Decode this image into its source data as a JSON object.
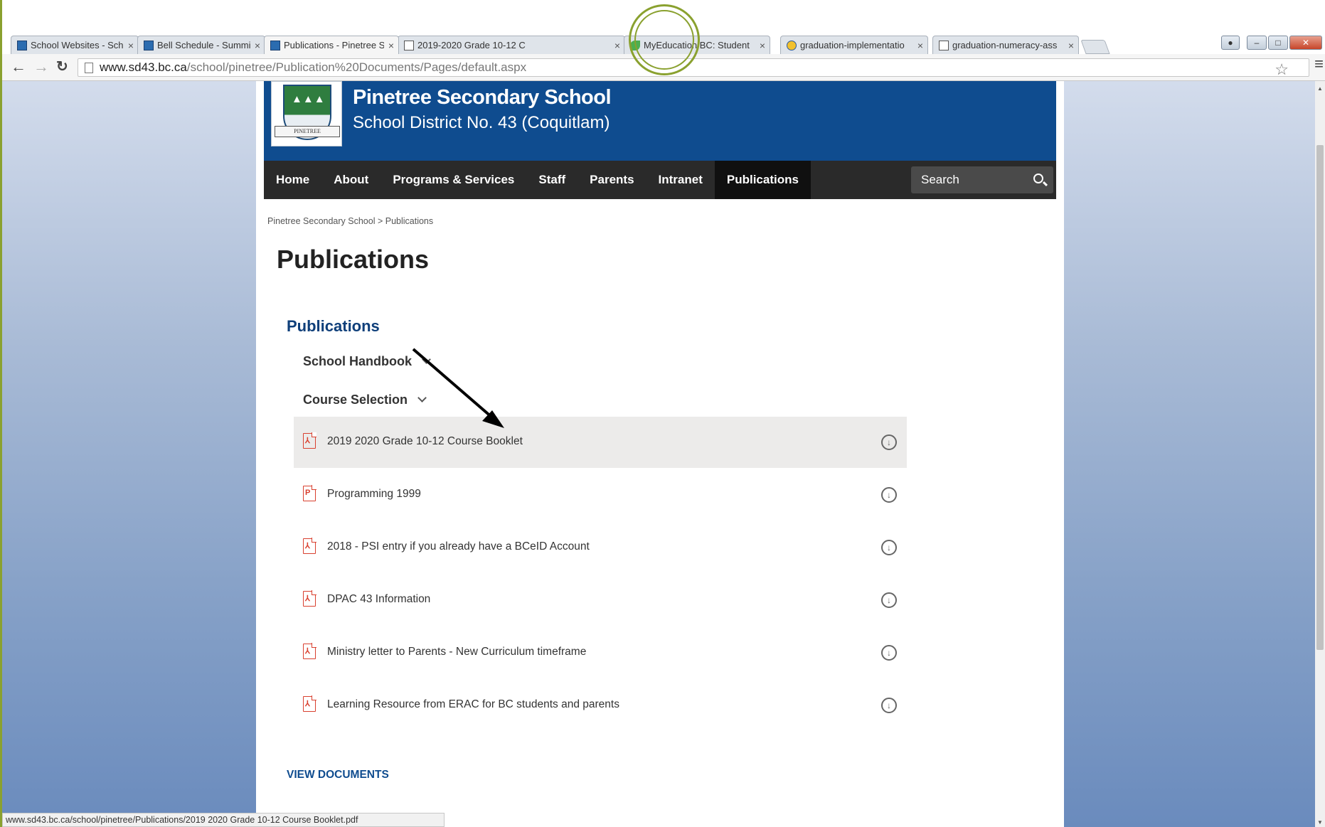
{
  "browser": {
    "tabs": [
      {
        "title": "School Websites - School",
        "icon": "sd43-icon",
        "active": false
      },
      {
        "title": "Bell Schedule - Summit M",
        "icon": "sd43-icon",
        "active": false
      },
      {
        "title": "Publications - Pinetree Se",
        "icon": "sd43-icon",
        "active": true
      },
      {
        "title": "2019-2020 Grade 10-12 C",
        "icon": "document-icon",
        "active": false
      },
      {
        "title": "MyEducation BC: Student",
        "icon": "leaf-icon",
        "active": false
      },
      {
        "title": "graduation-implementatio",
        "icon": "bc-gov-icon",
        "active": false
      },
      {
        "title": "graduation-numeracy-ass",
        "icon": "document-icon",
        "active": false
      }
    ],
    "tab_close_glyph": "×",
    "url_domain": "www.sd43.bc.ca",
    "url_path": "/school/pinetree/Publication%20Documents/Pages/default.aspx",
    "status_url": "www.sd43.bc.ca/school/pinetree/Publications/2019 2020 Grade 10-12 Course Booklet.pdf"
  },
  "site": {
    "school_name": "Pinetree Secondary School",
    "district_name": "School District No. 43 (Coquitlam)",
    "crest_ribbon": "PINETREE",
    "nav": [
      "Home",
      "About",
      "Programs & Services",
      "Staff",
      "Parents",
      "Intranet",
      "Publications"
    ],
    "active_nav": "Publications",
    "search_placeholder": "Search",
    "brand_color": "#0f4c8f",
    "nav_color": "#2a2a2a",
    "pdf_icon_color": "#d9402f"
  },
  "page": {
    "breadcrumb": "Pinetree Secondary School > Publications",
    "title": "Publications",
    "section_title": "Publications",
    "groups": [
      {
        "label": "School Handbook",
        "expanded": false
      },
      {
        "label": "Course Selection",
        "expanded": true
      }
    ],
    "documents": [
      {
        "title": "2019 2020 Grade 10-12 Course Booklet",
        "icon": "pdf-icon",
        "highlighted": true
      },
      {
        "title": "Programming 1999",
        "icon": "publisher-file-icon",
        "highlighted": false
      },
      {
        "title": "2018 - PSI entry if you already have a BCeID Account",
        "icon": "pdf-icon",
        "highlighted": false
      },
      {
        "title": "DPAC 43 Information",
        "icon": "pdf-icon",
        "highlighted": false
      },
      {
        "title": "Ministry letter to Parents - New Curriculum timeframe",
        "icon": "pdf-icon",
        "highlighted": false
      },
      {
        "title": "Learning Resource from ERAC for BC students and parents",
        "icon": "pdf-icon",
        "highlighted": false
      }
    ],
    "view_documents": "VIEW DOCUMENTS"
  },
  "slide": {
    "accent_color": "#8aa12f"
  }
}
